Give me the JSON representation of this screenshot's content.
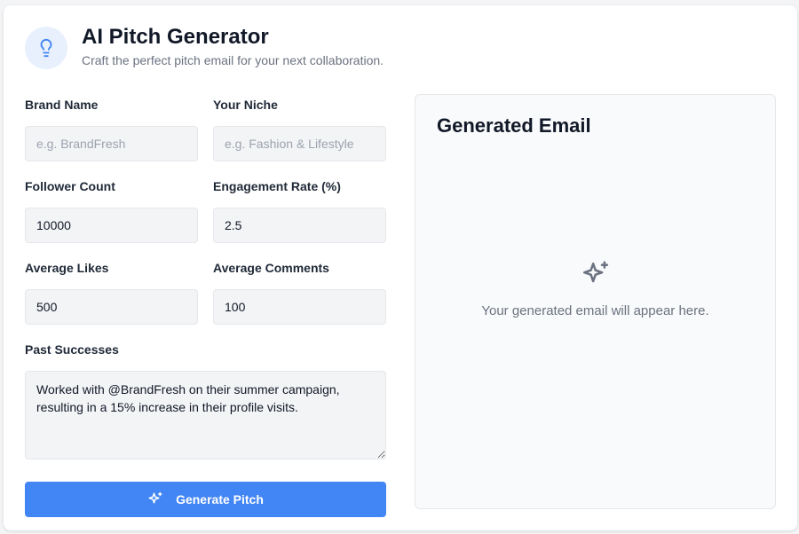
{
  "header": {
    "icon": "lightbulb-icon",
    "title": "AI Pitch Generator",
    "subtitle": "Craft the perfect pitch email for your next collaboration."
  },
  "form": {
    "brand_name": {
      "label": "Brand Name",
      "value": "",
      "placeholder": "e.g. BrandFresh"
    },
    "niche": {
      "label": "Your Niche",
      "value": "",
      "placeholder": "e.g. Fashion & Lifestyle"
    },
    "follower_count": {
      "label": "Follower Count",
      "value": "10000"
    },
    "engagement_rate": {
      "label": "Engagement Rate (%)",
      "value": "2.5"
    },
    "average_likes": {
      "label": "Average Likes",
      "value": "500"
    },
    "average_comments": {
      "label": "Average Comments",
      "value": "100"
    },
    "past_successes": {
      "label": "Past Successes",
      "value": "Worked with @BrandFresh on their summer campaign, resulting in a 15% increase in their profile visits."
    },
    "generate_button": {
      "label": "Generate Pitch",
      "icon": "sparkles-icon"
    }
  },
  "output": {
    "title": "Generated Email",
    "empty_icon": "sparkles-icon",
    "empty_text": "Your generated email will appear here."
  },
  "colors": {
    "accent": "#4285f4",
    "icon_bg": "#e8f0fd",
    "muted_text": "#6b7280"
  }
}
